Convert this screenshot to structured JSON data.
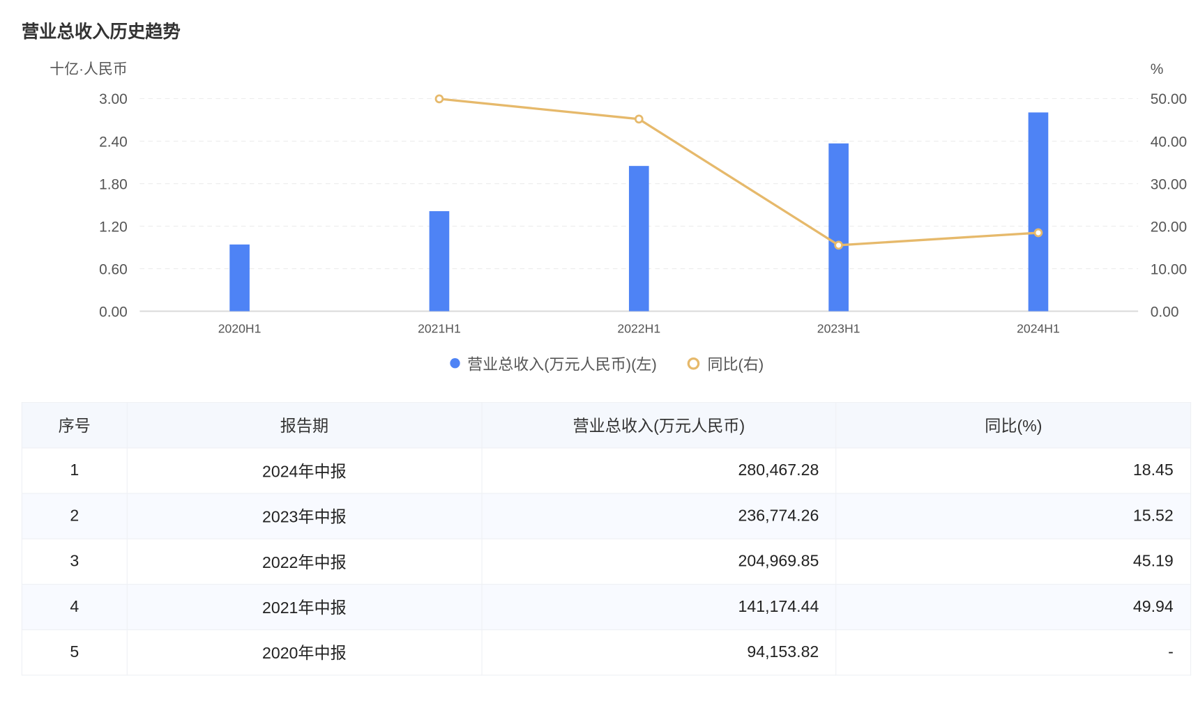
{
  "title": "营业总收入历史趋势",
  "chart_data": {
    "type": "bar+line",
    "categories": [
      "2020H1",
      "2021H1",
      "2022H1",
      "2023H1",
      "2024H1"
    ],
    "left_axis": {
      "label": "十亿·人民币",
      "ylim": [
        0,
        3
      ],
      "ticks": [
        "0.00",
        "0.60",
        "1.20",
        "1.80",
        "2.40",
        "3.00"
      ]
    },
    "right_axis": {
      "label": "%",
      "ylim": [
        0,
        50
      ],
      "ticks": [
        "0.00",
        "10.00",
        "20.00",
        "30.00",
        "40.00",
        "50.00"
      ]
    },
    "series": [
      {
        "name": "营业总收入(万元人民币)(左)",
        "type": "bar",
        "color": "#4e83f5",
        "values": [
          0.9415,
          1.4117,
          2.0497,
          2.3677,
          2.8047
        ]
      },
      {
        "name": "同比(右)",
        "type": "line",
        "color": "#e6b96b",
        "values": [
          null,
          49.94,
          45.19,
          15.52,
          18.45
        ]
      }
    ],
    "grid": true,
    "legend": "bottom"
  },
  "table": {
    "headers": [
      "序号",
      "报告期",
      "营业总收入(万元人民币)",
      "同比(%)"
    ],
    "rows": [
      [
        "1",
        "2024年中报",
        "280,467.28",
        "18.45"
      ],
      [
        "2",
        "2023年中报",
        "236,774.26",
        "15.52"
      ],
      [
        "3",
        "2022年中报",
        "204,969.85",
        "45.19"
      ],
      [
        "4",
        "2021年中报",
        "141,174.44",
        "49.94"
      ],
      [
        "5",
        "2020年中报",
        "94,153.82",
        "-"
      ]
    ]
  }
}
